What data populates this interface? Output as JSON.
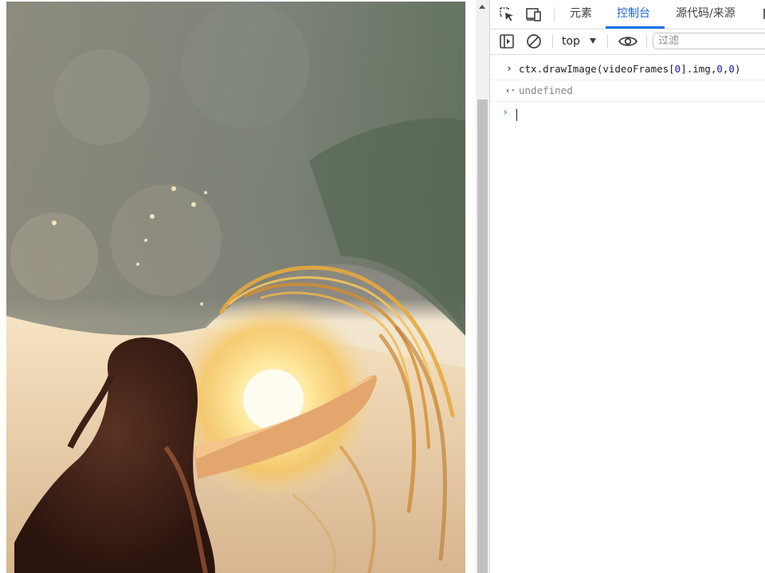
{
  "devtools": {
    "tabs": [
      {
        "label": "元素",
        "active": false
      },
      {
        "label": "控制台",
        "active": true
      },
      {
        "label": "源代码/来源",
        "active": false
      }
    ],
    "icons": {
      "inspect": "inspect-element-icon",
      "device": "device-toolbar-icon",
      "sidebar": "sidebar-toggle-icon",
      "clear": "clear-console-icon",
      "eye": "live-expression-eye-icon"
    },
    "accent_color": "#1a73e8"
  },
  "toolbar": {
    "context": "top",
    "filter_placeholder": "过滤"
  },
  "console": {
    "input_code": {
      "t1": "ctx.drawImage(videoFrames[",
      "n1": "0",
      "t2": "].img,",
      "n2": "0",
      "t3": ",",
      "n3": "0",
      "t4": ")"
    },
    "result": "undefined",
    "prompt_glyph": "›",
    "input_glyph": "›",
    "result_glyph": "‹·"
  }
}
